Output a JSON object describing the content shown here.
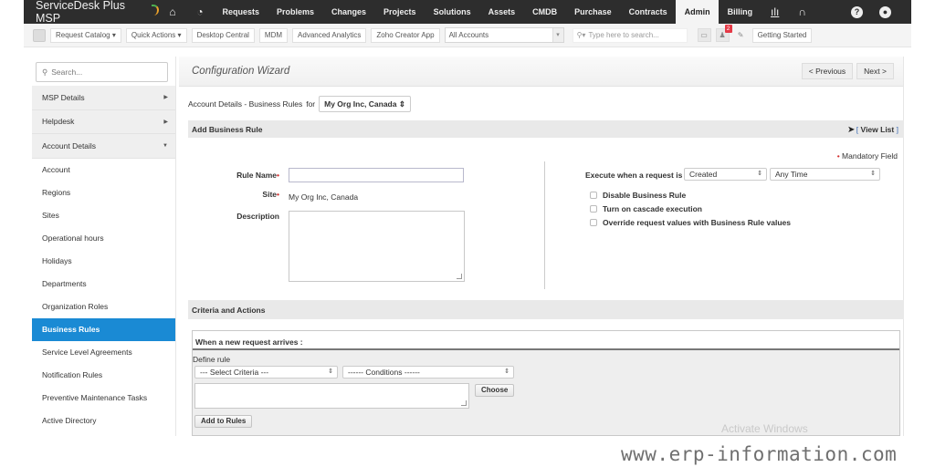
{
  "topnav": {
    "brand": "ServiceDesk Plus MSP",
    "items": [
      "Requests",
      "Problems",
      "Changes",
      "Projects",
      "Solutions",
      "Assets",
      "CMDB",
      "Purchase",
      "Contracts",
      "Admin",
      "Billing"
    ],
    "active": "Admin",
    "icons": [
      "home-icon",
      "dashboard-icon",
      "reports-icon",
      "support-icon",
      "help-icon",
      "user-settings-icon"
    ]
  },
  "toolbar": {
    "buttons": [
      "Request Catalog",
      "Quick Actions",
      "Desktop Central",
      "MDM",
      "Advanced Analytics",
      "Zoho Creator App"
    ],
    "accounts_select": "All Accounts",
    "search_placeholder": "Type here to search...",
    "notification_count": "2",
    "getting_started": "Getting Started"
  },
  "sidebar": {
    "search_placeholder": "Search...",
    "groups": [
      "MSP Details",
      "Helpdesk",
      "Account Details"
    ],
    "items": [
      "Account",
      "Regions",
      "Sites",
      "Operational hours",
      "Holidays",
      "Departments",
      "Organization Roles",
      "Business Rules",
      "Service Level Agreements",
      "Notification Rules",
      "Preventive Maintenance Tasks",
      "Active Directory"
    ],
    "active_item": "Business Rules"
  },
  "main": {
    "title": "Configuration Wizard",
    "previous": "Previous",
    "next": "Next",
    "context_label": "Account Details - Business Rules",
    "for_label": "for",
    "account_select": "My Org Inc, Canada",
    "add_section": "Add Business Rule",
    "view_list": "View List",
    "mandatory": "Mandatory Field",
    "rule_name_label": "Rule Name",
    "rule_name_value": "",
    "site_label": "Site",
    "site_value": "My Org Inc, Canada",
    "description_label": "Description",
    "execute_label": "Execute when a request is",
    "execute_event": "Created",
    "execute_time": "Any Time",
    "checkboxes": [
      {
        "label": "Disable Business Rule",
        "checked": false
      },
      {
        "label": "Turn on cascade execution",
        "checked": false
      },
      {
        "label": "Override request values with Business Rule values",
        "checked": false
      }
    ],
    "criteria_section": "Criteria and Actions",
    "when_label": "When a new request arrives :",
    "define_rule": "Define rule",
    "select_criteria": "--- Select Criteria ---",
    "conditions": "------ Conditions ------",
    "choose": "Choose",
    "add_to_rules": "Add to Rules"
  },
  "overlay": {
    "activate_windows": "Activate Windows",
    "site_watermark": "www.erp-information.com"
  },
  "colors": {
    "topnav_bg": "#2d2d2d",
    "active_sidebar": "#1a8ad4",
    "required": "#d32f2f",
    "badge": "#e53946"
  }
}
